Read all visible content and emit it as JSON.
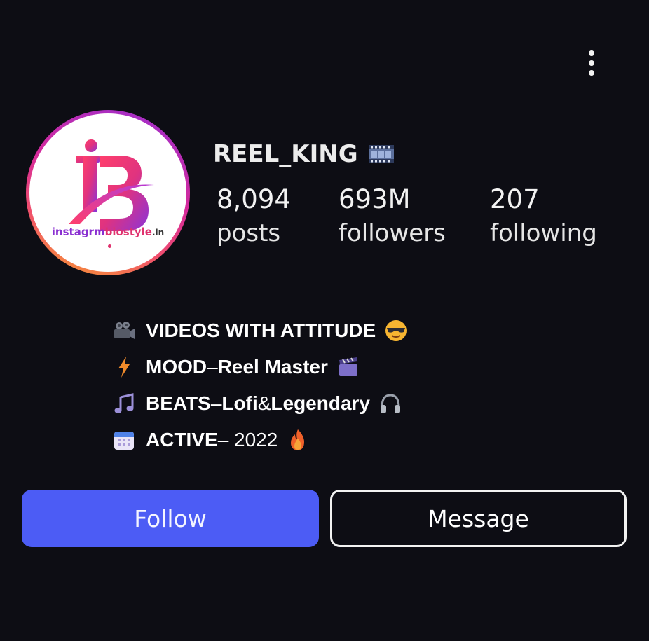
{
  "profile": {
    "username": "REEL_KING",
    "username_icon": "film-frames-icon",
    "avatar_logo": {
      "brand_name_part1": "instagrm",
      "brand_name_part2": "biostyle",
      "brand_name_part3": ".in"
    }
  },
  "stats": [
    {
      "value": "8,094",
      "label": "posts"
    },
    {
      "value": "693M",
      "label": "followers"
    },
    {
      "value": "207",
      "label": "following"
    }
  ],
  "bio": [
    {
      "icon": "movie-camera-icon",
      "bold": "VIDEOS WITH ATTITUDE",
      "rest": "",
      "trail_icon": "sunglasses-face-icon"
    },
    {
      "icon": "lightning-icon",
      "bold": "MOOD",
      "rest": " – ",
      "bold2": "Reel Master",
      "trail_icon": "clapper-board-icon"
    },
    {
      "icon": "music-notes-icon",
      "bold": "BEATS",
      "rest": " – ",
      "bold2": "Lofi",
      "mid": " & ",
      "bold3": "Legendary",
      "trail_icon": "headphones-icon"
    },
    {
      "icon": "calendar-icon",
      "bold": "ACTIVE",
      "rest": " – 2022",
      "trail_icon": "fire-icon"
    }
  ],
  "actions": {
    "follow_label": "Follow",
    "message_label": "Message"
  },
  "colors": {
    "background": "#0d0d14",
    "follow_button": "#4c5cf5",
    "ring_gradient": [
      "#9a2fd1",
      "#d62a9a",
      "#f04e6e",
      "#f7a02a"
    ]
  }
}
